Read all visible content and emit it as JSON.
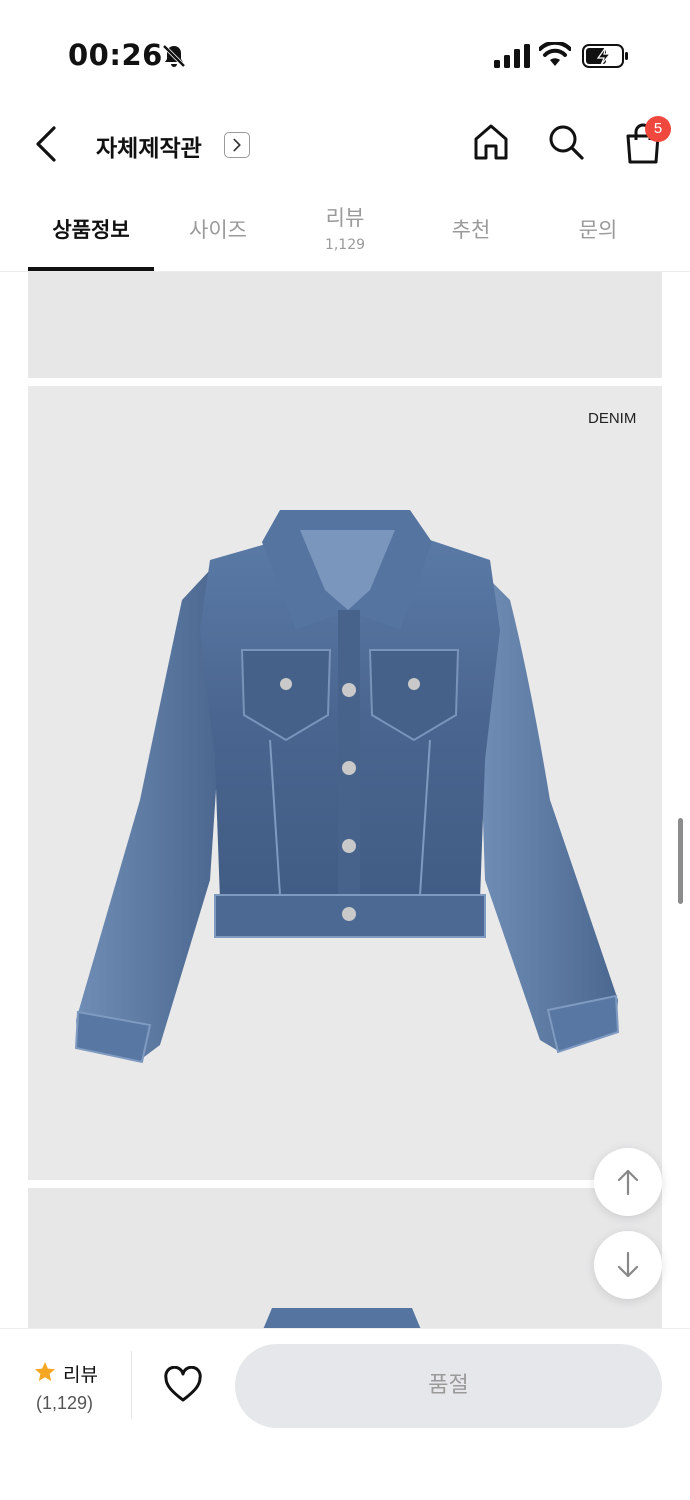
{
  "status_bar": {
    "time": "00:26",
    "icons": [
      "bell-off-icon",
      "signal-icon",
      "wifi-icon",
      "battery-charging-icon"
    ]
  },
  "header": {
    "store_title": "자체제작관",
    "cart_badge": "5",
    "icons": [
      "back-arrow-icon",
      "chevron-right-icon",
      "home-icon",
      "search-icon",
      "shopping-bag-icon"
    ]
  },
  "tabs": [
    {
      "label": "상품정보",
      "active": true
    },
    {
      "label": "사이즈"
    },
    {
      "label": "리뷰",
      "count": "1,129"
    },
    {
      "label": "추천"
    },
    {
      "label": "문의"
    }
  ],
  "content": {
    "image_label": "DENIM",
    "image_description_icon": "denim-jacket-image"
  },
  "floating": {
    "icons": [
      "arrow-up-icon",
      "arrow-down-icon"
    ]
  },
  "bottom_bar": {
    "review_label": "리뷰",
    "review_count": "(1,129)",
    "soldout_label": "품절",
    "icons": [
      "star-icon",
      "heart-icon"
    ]
  },
  "colors": {
    "accent_badge": "#f0473e",
    "star": "#f5a623",
    "panel_bg": "#e9e9ea",
    "denim": "#4a6690"
  }
}
